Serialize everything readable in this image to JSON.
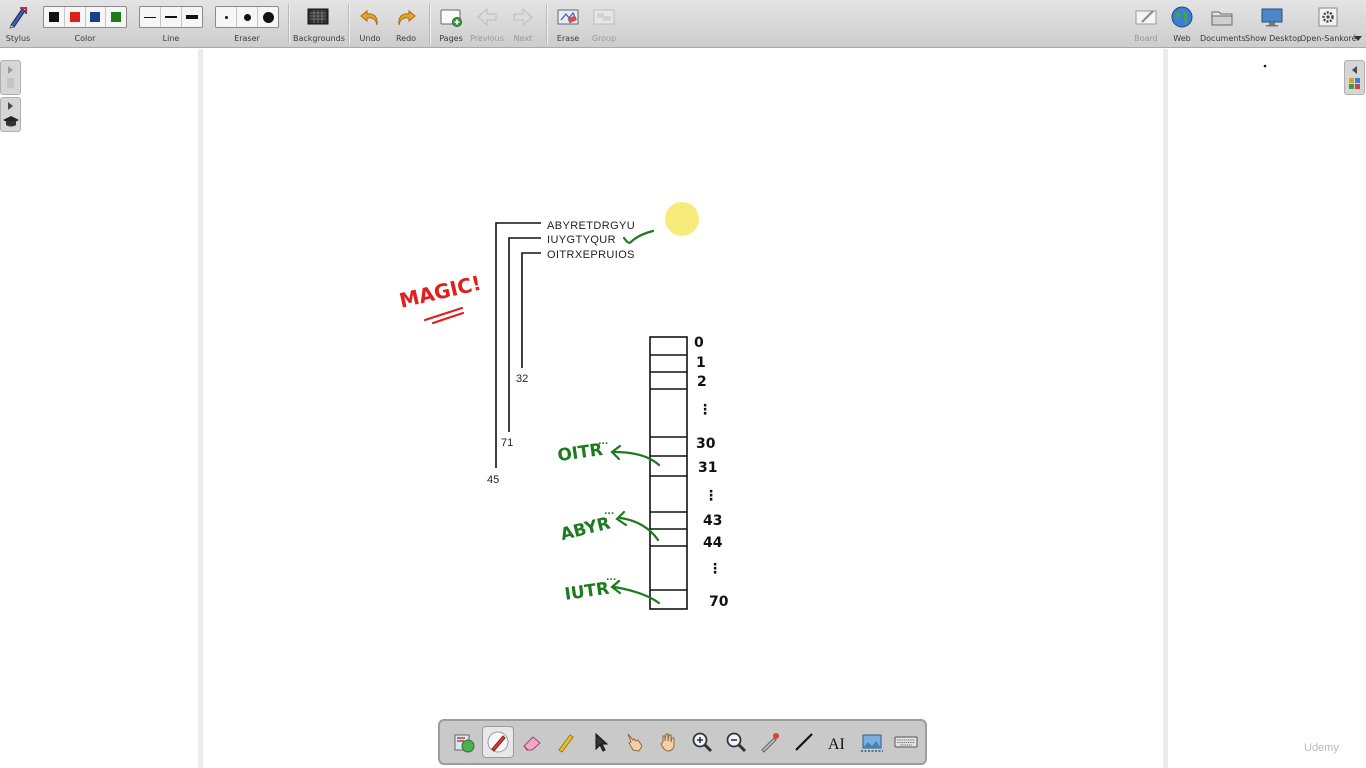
{
  "toolbar": {
    "stylus": "Stylus",
    "color": "Color",
    "colors": [
      "#111111",
      "#e0201c",
      "#1a3f8c",
      "#1d7a1d"
    ],
    "line": "Line",
    "eraser": "Eraser",
    "backgrounds": "Backgrounds",
    "undo": "Undo",
    "redo": "Redo",
    "pages": "Pages",
    "previous": "Previous",
    "next": "Next",
    "erase": "Erase",
    "group": "Group",
    "board": "Board",
    "web": "Web",
    "documents": "Documents",
    "show_desktop": "Show Desktop",
    "open_sankore": "Open-Sankoré"
  },
  "board": {
    "strings": [
      "ABYRETDRGYU",
      "IUYGTYQUR",
      "OITRXEPRUIOS"
    ],
    "hash_values": [
      "32",
      "71",
      "45"
    ],
    "magic": "MAGIC!",
    "table_indices": [
      "0",
      "1",
      "2",
      "30",
      "31",
      "43",
      "44",
      "70"
    ],
    "table_ellipsis": "⋮",
    "entries": [
      "OITR",
      "ABYR",
      "IUTR"
    ],
    "entry_suffix": "..."
  },
  "palette": {
    "tools": [
      "library-icon",
      "pen-icon",
      "eraser-icon",
      "highlighter-icon",
      "selector-icon",
      "pointer-hand-icon",
      "grab-hand-icon",
      "zoom-in-icon",
      "zoom-out-icon",
      "laser-pointer-icon",
      "line-icon",
      "text-icon",
      "capture-icon",
      "keyboard-icon"
    ],
    "text_tool_label": "AI"
  },
  "watermark": "Udemy",
  "accent": {
    "pen_green": "#1d7a1d",
    "pen_red": "#e0201c",
    "laser_yellow": "#f7ea74"
  }
}
